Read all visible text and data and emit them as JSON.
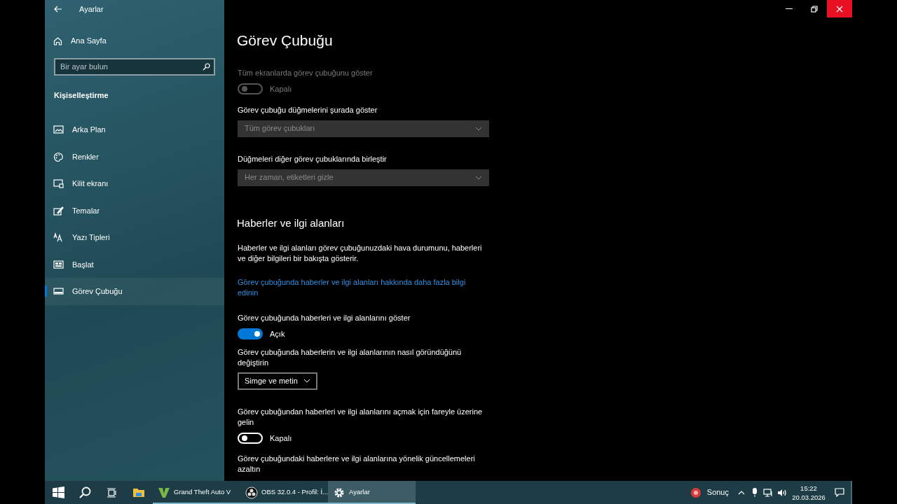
{
  "window": {
    "title": "Ayarlar"
  },
  "sidebar": {
    "home": "Ana Sayfa",
    "search": {
      "placeholder": "Bir ayar bulun"
    },
    "section": "Kişiselleştirme",
    "items": [
      {
        "label": "Arka Plan",
        "selected": false
      },
      {
        "label": "Renkler",
        "selected": false
      },
      {
        "label": "Kilit ekranı",
        "selected": false
      },
      {
        "label": "Temalar",
        "selected": false
      },
      {
        "label": "Yazı Tipleri",
        "selected": false
      },
      {
        "label": "Başlat",
        "selected": false
      },
      {
        "label": "Görev Çubuğu",
        "selected": true
      }
    ]
  },
  "page": {
    "title": "Görev Çubuğu",
    "settings": [
      {
        "kind": "toggle",
        "label": "Tüm ekranlarda görev çubuğunu göster",
        "on": false,
        "disabled": true,
        "state_text": "Kapalı"
      },
      {
        "kind": "select",
        "label": "Görev çubuğu düğmelerini şurada göster",
        "value": "Tüm görev çubukları",
        "disabled": true
      },
      {
        "kind": "select",
        "label": "Düğmeleri diğer görev çubuklarında birleştir",
        "value": "Her zaman, etiketleri gizle",
        "disabled": true
      },
      {
        "kind": "heading",
        "text": "Haberler ve ilgi alanları"
      },
      {
        "kind": "paragraph",
        "text": "Haberler ve ilgi alanları görev çubuğunuzdaki hava durumunu, haberleri ve diğer bilgileri bir bakışta gösterir."
      },
      {
        "kind": "link",
        "text": "Görev çubuğunda haberler ve ilgi alanları hakkında daha fazla bilgi edinin"
      },
      {
        "kind": "toggle",
        "label": "Görev çubuğunda haberleri ve ilgi alanlarını göster",
        "on": true,
        "disabled": false,
        "state_text": "Açık"
      },
      {
        "kind": "compact-select",
        "label": "Görev çubuğunda haberlerin ve ilgi alanlarının nasıl göründüğünü değiştirin",
        "value": "Simge ve metin",
        "disabled": false
      },
      {
        "kind": "toggle",
        "label": "Görev çubuğundan haberleri ve ilgi alanlarını açmak için fareyle üzerine gelin",
        "on": false,
        "disabled": false,
        "state_text": "Kapalı"
      },
      {
        "kind": "label",
        "text": "Görev çubuğundaki haberlere ve ilgi alanlarına yönelik güncellemeleri azaltın"
      }
    ]
  },
  "taskbar": {
    "apps": [
      {
        "label": "Grand Theft Auto V",
        "selected": false,
        "running": true
      },
      {
        "label": "OBS 32.0.4 - Profil: İ...",
        "selected": false,
        "running": true
      },
      {
        "label": "Ayarlar",
        "selected": true,
        "running": true
      }
    ],
    "weather": "Sonuç",
    "time": "15:22",
    "date": "20.03.2026"
  }
}
